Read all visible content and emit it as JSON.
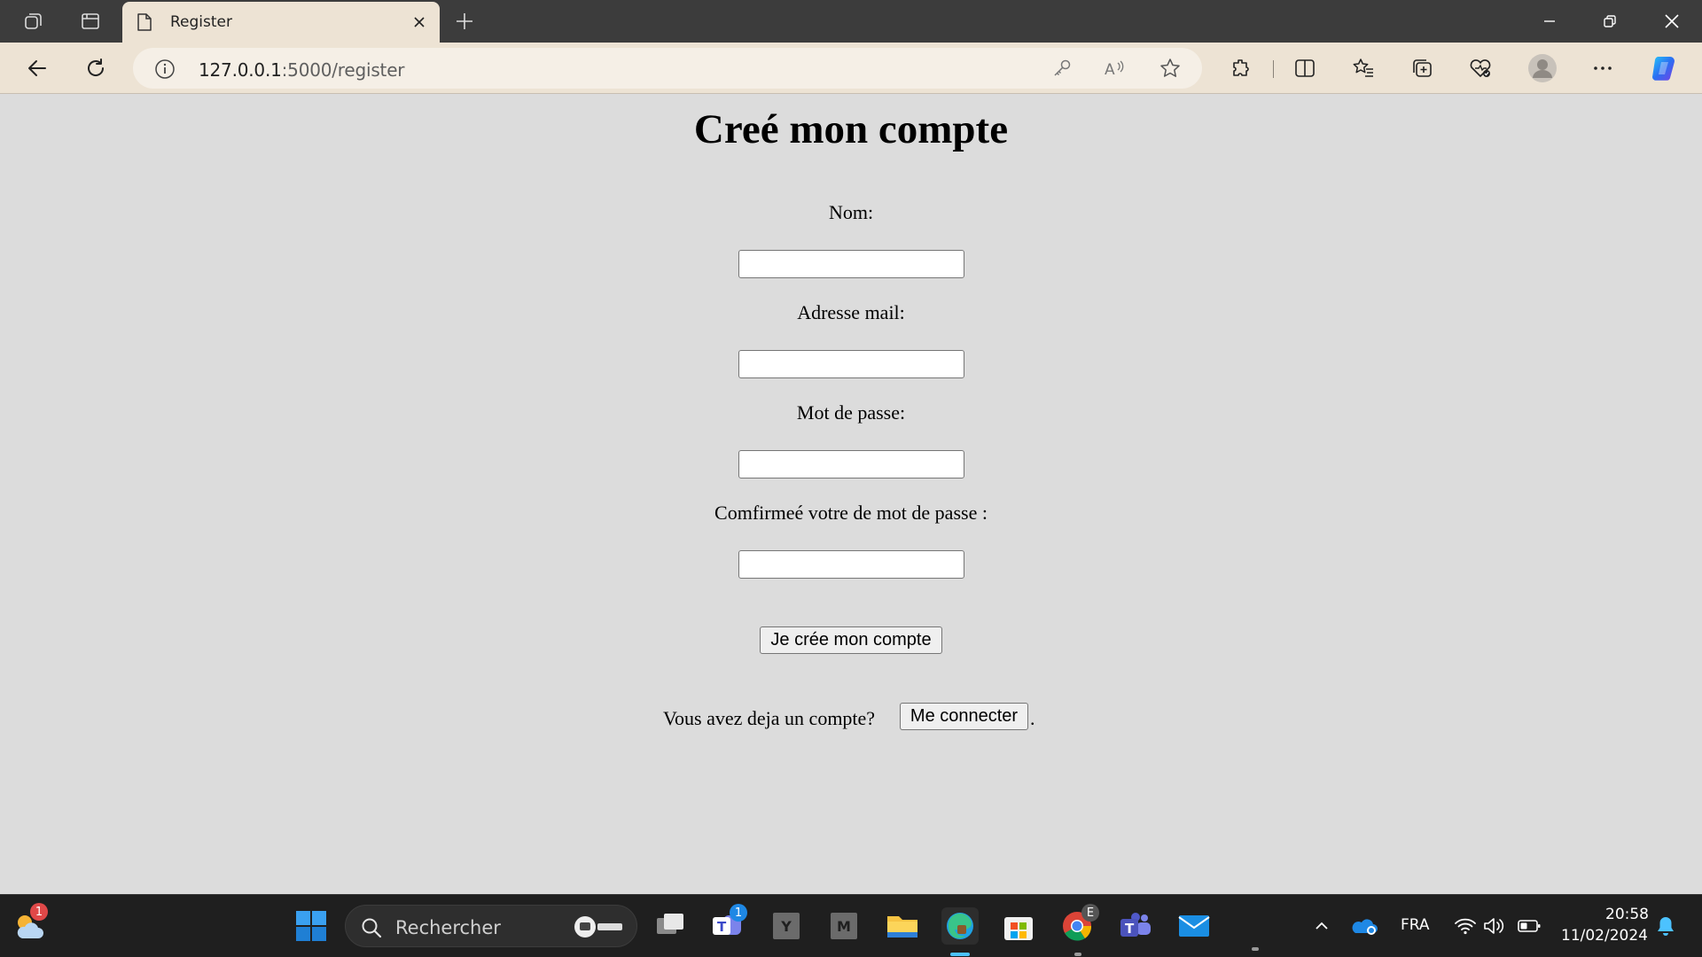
{
  "browser": {
    "tab_title": "Register",
    "url_host": "127.0.0.1",
    "url_path": ":5000/register"
  },
  "page": {
    "heading": "Creé mon compte",
    "name_label": "Nom:",
    "email_label": "Adresse mail:",
    "password_label": "Mot de passe:",
    "confirm_label": "Comfirmeé votre de mot de passe :",
    "submit_label": "Je crée mon compte",
    "login_prompt": "Vous avez deja un compte?",
    "login_button": "Me connecter",
    "login_suffix": "."
  },
  "taskbar": {
    "search_placeholder": "Rechercher",
    "weather_badge": "1",
    "teams_badge": "1",
    "chrome_badge": "E",
    "app_y": "Y",
    "app_m": "M",
    "language": "FRA",
    "time": "20:58",
    "date": "11/02/2024"
  },
  "colors": {
    "chrome_frame": "#3c3c3c",
    "toolbar": "#ede3d4",
    "page_bg": "#dcdcdc",
    "taskbar": "#1f1f1f",
    "accent": "#0078d4"
  }
}
